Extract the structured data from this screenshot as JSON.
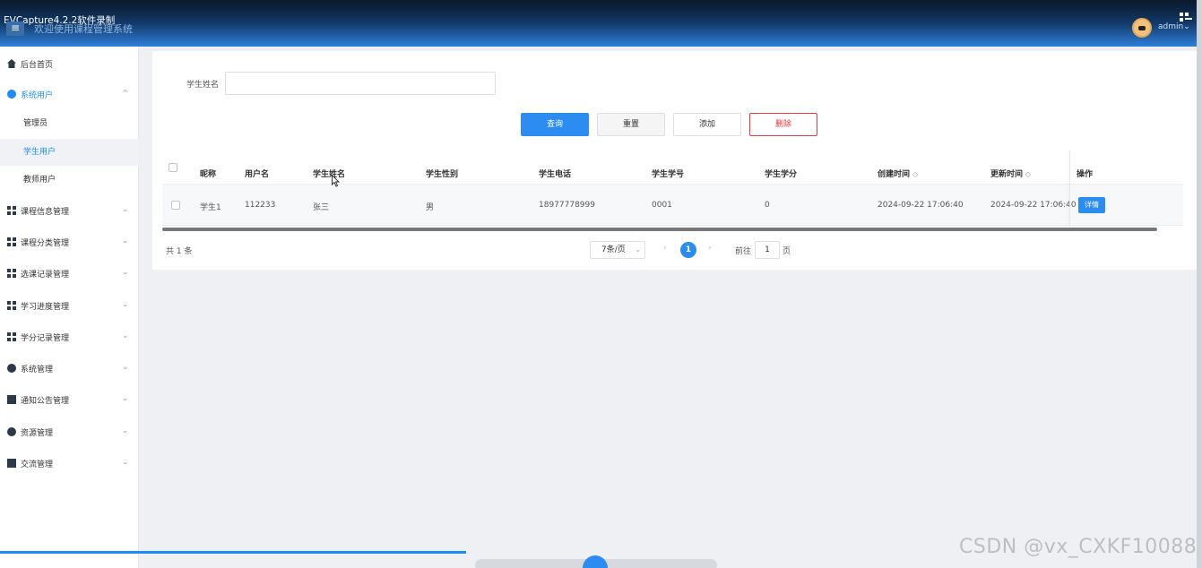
{
  "recorder": {
    "title": "EVCapture4.2.2软件录制",
    "watermark": "CSDN @vx_CXKF10088"
  },
  "header": {
    "menu_icon": "hamburger-icon",
    "title": "欢迎使用课程管理系统",
    "user": "admin"
  },
  "sidebar": {
    "items": [
      {
        "label": "后台首页",
        "icon": "home-icon"
      },
      {
        "label": "系统用户",
        "icon": "user-icon"
      },
      {
        "label": "课程信息管理",
        "icon": "grid-icon"
      },
      {
        "label": "课程分类管理",
        "icon": "grid-icon"
      },
      {
        "label": "选课记录管理",
        "icon": "grid-icon"
      },
      {
        "label": "学习进度管理",
        "icon": "grid-icon"
      },
      {
        "label": "学分记录管理",
        "icon": "grid-icon"
      },
      {
        "label": "系统管理",
        "icon": "gear-icon"
      },
      {
        "label": "通知公告管理",
        "icon": "document-icon"
      },
      {
        "label": "资源管理",
        "icon": "plus-circle-icon"
      },
      {
        "label": "交流管理",
        "icon": "chat-icon"
      }
    ],
    "sub_items": [
      {
        "label": "管理员"
      },
      {
        "label": "学生用户"
      },
      {
        "label": "教师用户"
      }
    ]
  },
  "search": {
    "label": "学生姓名",
    "value": ""
  },
  "buttons": {
    "query": "查询",
    "reset": "重置",
    "add": "添加",
    "delete": "删除"
  },
  "table": {
    "headers": [
      "昵称",
      "用户名",
      "学生姓名",
      "学生性别",
      "学生电话",
      "学生学号",
      "学生学分",
      "创建时间",
      "更新时间",
      "操作"
    ],
    "sort_icon": "◇",
    "rows": [
      {
        "nickname": "学生1",
        "username": "112233",
        "name": "张三",
        "gender": "男",
        "phone": "18977778999",
        "student_no": "0001",
        "credits": "0",
        "created": "2024-09-22 17:06:40",
        "updated": "2024-09-22 17:06:40",
        "action": "详情"
      }
    ]
  },
  "pagination": {
    "total": "共 1 条",
    "page_size": "7条/页",
    "prev": "‹",
    "current": "1",
    "next": "›",
    "goto_label": "前往",
    "goto_value": "1",
    "goto_unit": "页"
  },
  "colors": {
    "primary": "#2d8cf0",
    "danger": "#e4393c",
    "header_start": "#0d2340",
    "header_end": "#2f7fd9"
  }
}
